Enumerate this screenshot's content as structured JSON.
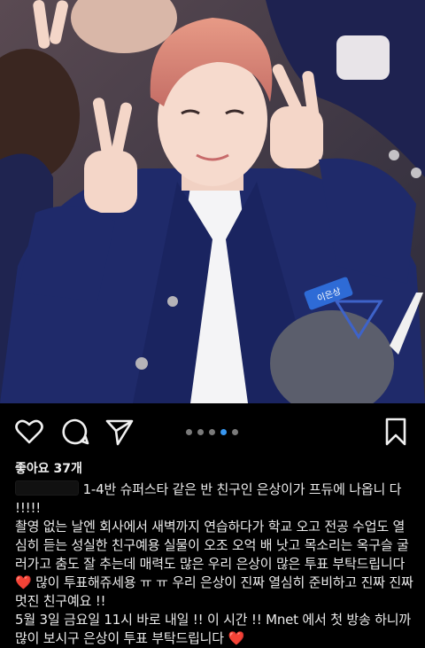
{
  "post": {
    "likes_label": "좋아요 37개",
    "carousel": {
      "count": 5,
      "active_index": 3
    },
    "caption": {
      "line1_a": "1-4반 슈퍼스타 같은 반 친구인 은상이가 프듀에 나옵니",
      "line1_b": "다 !!!!!",
      "para2": "촬영 없는 날엔 회사에서 새벽까지 연습하다가 학교 오고 전공 수업도 열심히 듣는 성실한 친구예용 실물이 오조 오억 배 낫고 목소리는 옥구슬 굴러가고 춤도 잘 추는데 매력도 많은 우리 은상이 많은 투표 부탁드립니다",
      "para2b": "많이 투표해쥬세용 ㅠ ㅠ 우리 은상이 진짜 열심히 준비하고 진짜 진짜 멋진 친구예요 !!",
      "para3": "5월 3일 금요일 11시 바로 내일 !! 이 시간 !! Mnet 에서 첫 방송 하니까 많이 보시구 은상이 투표 부탁드립니다",
      "heart": "❤️"
    },
    "photo": {
      "name_tag": "이은상"
    }
  },
  "icons": {
    "like": "heart-outline-icon",
    "comment": "comment-bubble-icon",
    "share": "paper-plane-icon",
    "save": "bookmark-icon"
  },
  "colors": {
    "background": "#000000",
    "dot_active": "#3897f0",
    "dot_inactive": "#7a7a7a",
    "heart": "#e02020"
  }
}
